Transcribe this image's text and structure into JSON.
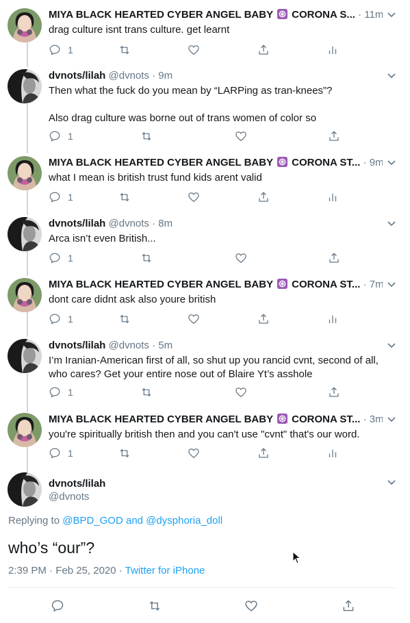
{
  "colors": {
    "text": "#14171a",
    "secondary": "#657786",
    "link": "#1da1f2",
    "thread": "#ccd6dd",
    "avatar_bg": "#6f8f5e"
  },
  "tweets": [
    {
      "name": "MIYA BLACK HEARTED CYBER ANGEL BABY ☸ CORONA S...",
      "handle": "",
      "time": "· 11m",
      "text": "drag culture isnt trans culture. get learnt",
      "reply_count": "1"
    },
    {
      "name": "dvnots/lilah",
      "handle": "@dvnots",
      "time": "· 9m",
      "text": "Then what the fuck do you mean by “LARPing as tran-knees”?\n\nAlso drag culture was borne out of trans women of color so",
      "reply_count": "1"
    },
    {
      "name": "MIYA BLACK HEARTED CYBER ANGEL BABY ☸ CORONA ST...",
      "handle": "",
      "time": "· 9m",
      "text": "what I mean is british trust fund kids arent valid",
      "reply_count": "1"
    },
    {
      "name": "dvnots/lilah",
      "handle": "@dvnots",
      "time": "· 8m",
      "text": "Arca isn’t even British...",
      "reply_count": "1"
    },
    {
      "name": "MIYA BLACK HEARTED CYBER ANGEL BABY ☸ CORONA ST...",
      "handle": "",
      "time": "· 7m",
      "text": "dont care didnt ask also youre british",
      "reply_count": "1"
    },
    {
      "name": "dvnots/lilah",
      "handle": "@dvnots",
      "time": "· 5m",
      "text": "I’m Iranian-American first of all, so shut up you rancid cvnt, second of all, who cares? Get your entire nose out of Blaire Yt’s asshole",
      "reply_count": "1"
    },
    {
      "name": "MIYA BLACK HEARTED CYBER ANGEL BABY ☸ CORONA ST...",
      "handle": "",
      "time": "· 3m",
      "text": "you're spiritually british then and you can't use \"cvnt\" that's our word.",
      "reply_count": "1"
    }
  ],
  "main": {
    "name": "dvnots/lilah",
    "handle": "@dvnots",
    "replying_prefix": "Replying to ",
    "replying_user1": "@BPD_GOD",
    "replying_and": " and ",
    "replying_user2": "@dysphoria_doll",
    "text": "who’s “our”?",
    "time": "2:39 PM · Feb 25, 2020 · ",
    "source": "Twitter for iPhone"
  }
}
